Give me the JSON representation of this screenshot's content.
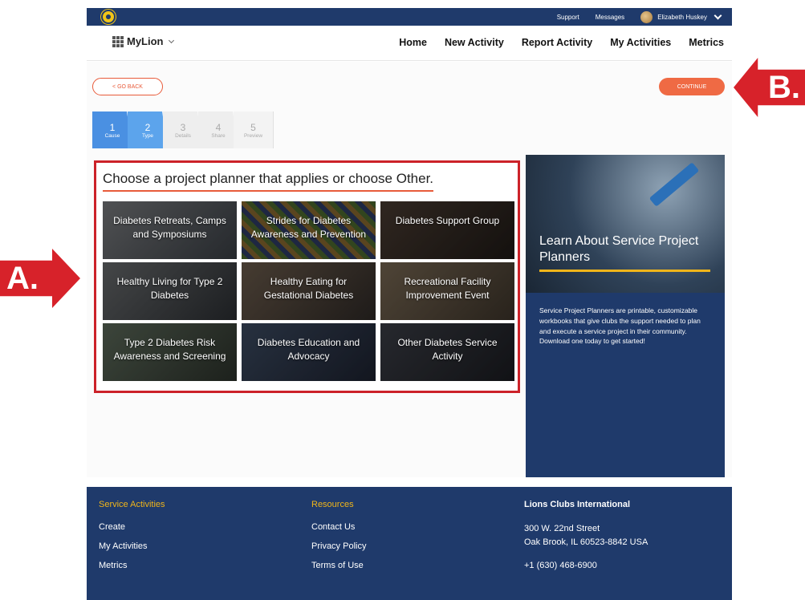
{
  "topbar": {
    "support": "Support",
    "messages": "Messages",
    "user_name": "Elizabeth Huskey"
  },
  "nav": {
    "brand": "MyLion",
    "links": [
      "Home",
      "New Activity",
      "Report Activity",
      "My Activities",
      "Metrics"
    ]
  },
  "actions": {
    "back": "< GO BACK",
    "continue": "CONTINUE"
  },
  "steps": [
    {
      "num": "1",
      "label": "Cause"
    },
    {
      "num": "2",
      "label": "Type"
    },
    {
      "num": "3",
      "label": "Details"
    },
    {
      "num": "4",
      "label": "Share"
    },
    {
      "num": "5",
      "label": "Preview"
    }
  ],
  "planner": {
    "title": "Choose a project planner that applies or choose Other.",
    "tiles": [
      "Diabetes Retreats, Camps and Symposiums",
      "Strides for Diabetes Awareness and Prevention",
      "Diabetes Support Group",
      "Healthy Living for Type 2 Diabetes",
      "Healthy Eating for Gestational Diabetes",
      "Recreational Facility Improvement Event",
      "Type 2 Diabetes Risk Awareness and Screening",
      "Diabetes Education and Advocacy",
      "Other Diabetes Service Activity"
    ]
  },
  "sidebar": {
    "title": "Learn About Service Project Planners",
    "text": "Service Project Planners are printable, customizable workbooks that give clubs the support needed to plan and execute a service project in their community. Download one today to get started!"
  },
  "footer": {
    "col1": {
      "heading": "Service Activities",
      "items": [
        "Create",
        "My Activities",
        "Metrics"
      ]
    },
    "col2": {
      "heading": "Resources",
      "items": [
        "Contact Us",
        "Privacy Policy",
        "Terms of Use"
      ]
    },
    "col3": {
      "heading": "Lions Clubs International",
      "address1": "300 W. 22nd Street",
      "address2": "Oak Brook, IL 60523-8842 USA",
      "phone": "+1 (630) 468-6900"
    }
  },
  "annotations": {
    "a": "A.",
    "b": "B."
  },
  "colors": {
    "navy": "#1f3a6b",
    "accent_orange": "#ef6a44",
    "callout_red": "#d7222a",
    "gold": "#f0b51a"
  }
}
